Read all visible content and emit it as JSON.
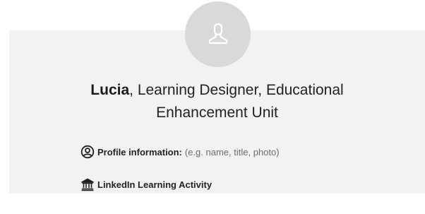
{
  "profile": {
    "name": "Lucia",
    "role_line1": ", Learning Designer, Educational",
    "role_line2": "Enhancement Unit"
  },
  "fields": {
    "profile_info_label": "Profile information:",
    "profile_info_hint": "(e.g. name, title, photo)",
    "linkedin_label": "LinkedIn Learning Activity"
  },
  "icons": {
    "avatar": "user-silhouette-icon",
    "profile": "profile-circle-icon",
    "linkedin": "institution-icon"
  },
  "colors": {
    "card_background": "#f2f2f2",
    "avatar_background": "#d9d9d9",
    "avatar_glyph": "#ffffff",
    "text": "#222222",
    "hint_text": "#6b6b6b"
  }
}
